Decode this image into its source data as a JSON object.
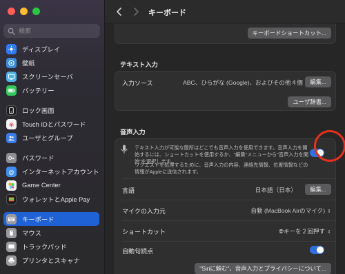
{
  "window": {
    "page_title": "キーボード"
  },
  "sidebar": {
    "search_placeholder": "検索",
    "items": [
      {
        "label": "ディスプレイ",
        "icon": "display-icon",
        "color": "#2e7bf6"
      },
      {
        "label": "壁紙",
        "icon": "wallpaper-icon",
        "color": "#3a8dde"
      },
      {
        "label": "スクリーンセーバ",
        "icon": "screensaver-icon",
        "color": "#4fb3e8"
      },
      {
        "label": "バッテリー",
        "icon": "battery-icon",
        "color": "#34c759"
      },
      {
        "label": "ロック画面",
        "icon": "lock-screen-icon",
        "color": "#1c1c1e"
      },
      {
        "label": "Touch IDとパスワード",
        "icon": "fingerprint-icon",
        "color": "#f2f2f2"
      },
      {
        "label": "ユーザとグループ",
        "icon": "users-icon",
        "color": "#3b7de8"
      },
      {
        "label": "パスワード",
        "icon": "key-icon",
        "color": "#8e8e93"
      },
      {
        "label": "インターネットアカウント",
        "icon": "at-icon",
        "color": "#3d8ff0"
      },
      {
        "label": "Game Center",
        "icon": "game-center-icon",
        "color": "#f2f2f2"
      },
      {
        "label": "ウォレットとApple Pay",
        "icon": "wallet-icon",
        "color": "#1c1c1e"
      },
      {
        "label": "キーボード",
        "icon": "keyboard-icon",
        "color": "#9a9a9e",
        "active": true
      },
      {
        "label": "マウス",
        "icon": "mouse-icon",
        "color": "#9a9a9e"
      },
      {
        "label": "トラックパッド",
        "icon": "trackpad-icon",
        "color": "#9a9a9e"
      },
      {
        "label": "プリンタとスキャナ",
        "icon": "printer-icon",
        "color": "#9a9a9e"
      }
    ]
  },
  "main": {
    "shortcuts_button": "キーボードショートカット...",
    "text_input": {
      "title": "テキスト入力",
      "input_sources_label": "入力ソース",
      "input_sources_value": "ABC、ひらがな (Google)、およびその他４個",
      "edit_button": "編集...",
      "user_dict_button": "ユーザ辞書..."
    },
    "voice_input": {
      "title": "音声入力",
      "description_1": "テキスト入力が可能な箇所はどこでも音声入力を使用できます。音声入力を開始するには、ショートカットを使用するか、\"編集\"メニューから\"音声入力を開始\"を選択します。",
      "description_2": "リクエストを処理するために、音声入力の内容、連絡先情報、位置情報などの情報がAppleに送信されます。",
      "enabled": true,
      "language_label": "言語",
      "language_value": "日本語（日本）",
      "language_edit": "編集...",
      "mic_label": "マイクの入力元",
      "mic_value": "自動 (MacBook Airのマイク)",
      "shortcut_label": "ショートカット",
      "shortcut_value": "キーを２回押す",
      "auto_punct_label": "自動句読点",
      "auto_punct_enabled": true,
      "privacy_button": "\"Siriに頼む\"、音声入力とプライバシーについて..."
    }
  },
  "colors": {
    "accent": "#1f62d6",
    "toggle_on": "#2f6fe0",
    "highlight_ring": "#e4301e"
  }
}
